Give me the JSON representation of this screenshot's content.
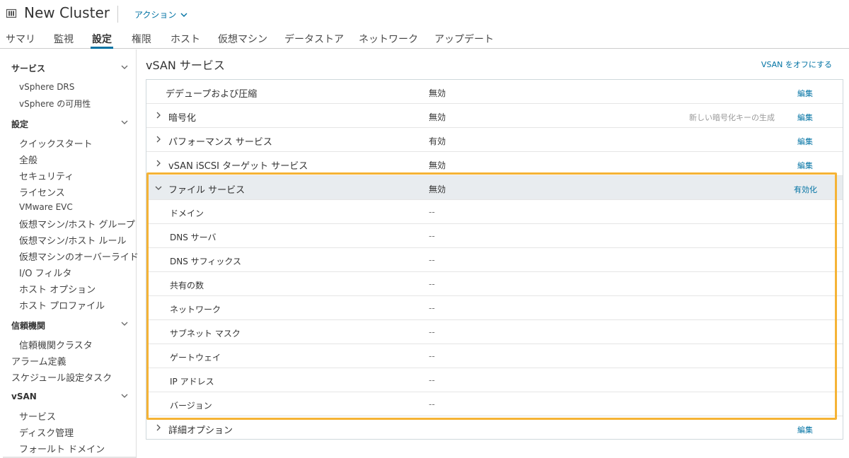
{
  "header": {
    "title": "New Cluster",
    "actions_label": "アクション"
  },
  "tabs": [
    {
      "label": "サマリ"
    },
    {
      "label": "監視"
    },
    {
      "label": "設定"
    },
    {
      "label": "権限"
    },
    {
      "label": "ホスト"
    },
    {
      "label": "仮想マシン"
    },
    {
      "label": "データストア"
    },
    {
      "label": "ネットワーク"
    },
    {
      "label": "アップデート"
    }
  ],
  "sidebar": {
    "services_group": "サービス",
    "services_items": [
      "vSphere DRS",
      "vSphere の可用性"
    ],
    "settings_group": "設定",
    "settings_items": [
      "クイックスタート",
      "全般",
      "セキュリティ",
      "ライセンス",
      "VMware EVC",
      "仮想マシン/ホスト グループ",
      "仮想マシン/ホスト ルール",
      "仮想マシンのオーバーライド",
      "I/O フィルタ",
      "ホスト オプション",
      "ホスト プロファイル"
    ],
    "trust_group": "信頼機関",
    "trust_items": [
      "信頼機関クラスタ"
    ],
    "top_items": [
      "アラーム定義",
      "スケジュール設定タスク"
    ],
    "vsan_group": "vSAN",
    "vsan_items": [
      "サービス",
      "ディスク管理",
      "フォールト ドメイン"
    ]
  },
  "main": {
    "title": "vSAN サービス",
    "turn_off_link": "VSAN をオフにする",
    "rows": [
      {
        "label": "デデュープおよび圧縮",
        "value": "無効",
        "link": "編集"
      },
      {
        "label": "暗号化",
        "value": "無効",
        "note": "新しい暗号化キーの生成",
        "link": "編集"
      },
      {
        "label": "パフォーマンス サービス",
        "value": "有効",
        "link": "編集"
      },
      {
        "label": "vSAN iSCSI ターゲット サービス",
        "value": "無効",
        "link": "編集"
      },
      {
        "label": "ファイル サービス",
        "value": "無効",
        "link": "有効化"
      }
    ],
    "file_service_rows": [
      {
        "label": "ドメイン",
        "value": "--"
      },
      {
        "label": "DNS サーバ",
        "value": "--"
      },
      {
        "label": "DNS サフィックス",
        "value": "--"
      },
      {
        "label": "共有の数",
        "value": "--"
      },
      {
        "label": "ネットワーク",
        "value": "--"
      },
      {
        "label": "サブネット マスク",
        "value": "--"
      },
      {
        "label": "ゲートウェイ",
        "value": "--"
      },
      {
        "label": "IP アドレス",
        "value": "--"
      },
      {
        "label": "バージョン",
        "value": "--"
      }
    ],
    "advanced": {
      "label": "詳細オプション",
      "link": "編集"
    }
  },
  "colors": {
    "accent": "#0072a3",
    "highlight": "#f5b335",
    "expanded_row": "#e8ecef"
  }
}
